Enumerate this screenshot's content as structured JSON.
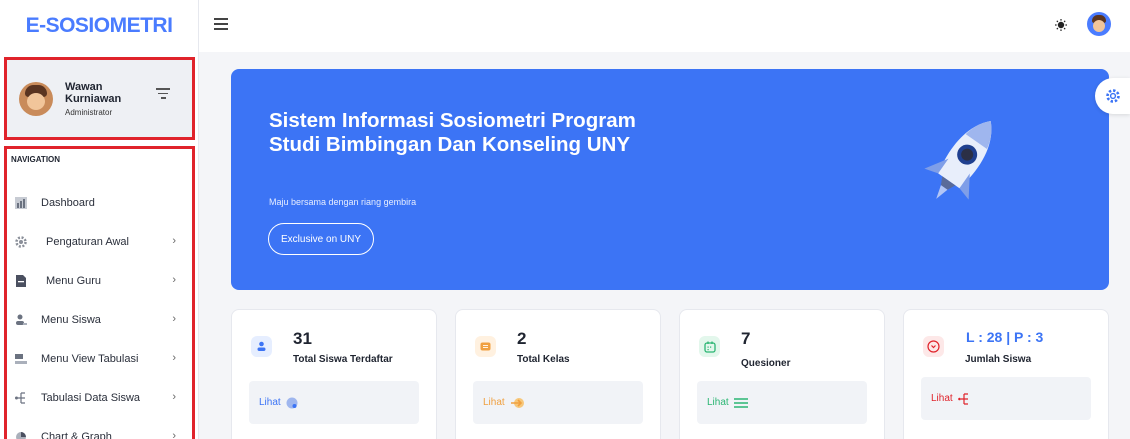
{
  "brand": {
    "logo_text": "E-SOSIOMETRI",
    "color": "#4a7cff"
  },
  "user": {
    "name": "Wawan Kurniawan",
    "role": "Administrator"
  },
  "navigation": {
    "heading": "NAVIGATION",
    "items": [
      {
        "label": "Dashboard",
        "icon": "chart-icon",
        "has_submenu": false
      },
      {
        "label": "Pengaturan Awal",
        "icon": "gear-icon",
        "has_submenu": true
      },
      {
        "label": "Menu Guru",
        "icon": "document-icon",
        "has_submenu": true
      },
      {
        "label": "Menu Siswa",
        "icon": "users-icon",
        "has_submenu": true
      },
      {
        "label": "Menu View Tabulasi",
        "icon": "table-icon",
        "has_submenu": true
      },
      {
        "label": "Tabulasi Data Siswa",
        "icon": "hierarchy-icon",
        "has_submenu": true
      },
      {
        "label": "Chart & Graph",
        "icon": "pie-chart-icon",
        "has_submenu": true
      }
    ]
  },
  "topbar": {
    "menu_icon": "hamburger-icon",
    "theme_icon": "sun-icon",
    "avatar_icon": "user-avatar-icon"
  },
  "banner": {
    "title": "Sistem Informasi Sosiometri Program Studi Bimbingan Dan Konseling UNY",
    "subtitle": "Maju bersama dengan riang gembira",
    "button_label": "Exclusive on UNY",
    "background_color": "#3c74f5",
    "illustration": "rocket-illustration"
  },
  "settings_icon": "settings-gear-icon",
  "stats": [
    {
      "value": "31",
      "label": "Total Siswa Terdaftar",
      "link_label": "Lihat",
      "icon": "user-icon",
      "accent": "#3c74f5",
      "tint": "#e6eeff"
    },
    {
      "value": "2",
      "label": "Total Kelas",
      "link_label": "Lihat",
      "icon": "class-icon",
      "accent": "#f0a040",
      "tint": "#fff1e0"
    },
    {
      "value": "7",
      "label": "Quesioner",
      "link_label": "Lihat",
      "icon": "calendar-icon",
      "accent": "#2bb673",
      "tint": "#e3f7ec"
    },
    {
      "value": "L : 28 | P : 3",
      "label": "Jumlah Siswa",
      "link_label": "Lihat",
      "icon": "chevron-circle-icon",
      "accent": "#e0232b",
      "tint": "#fde8e8"
    }
  ]
}
